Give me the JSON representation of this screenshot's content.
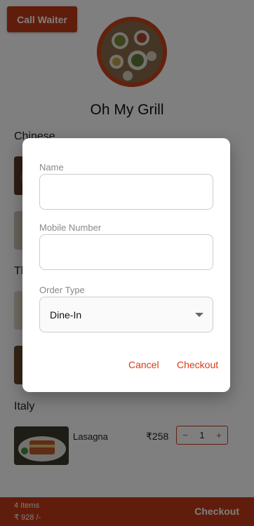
{
  "header": {
    "call_waiter_label": "Call Waiter",
    "restaurant_name": "Oh My Grill"
  },
  "sections": {
    "chinese": "Chinese",
    "second_partial": "Th",
    "italy": "Italy"
  },
  "menu_item": {
    "name": "Lasagna",
    "price": "₹258",
    "minus": "−",
    "quantity": "1",
    "plus": "+"
  },
  "footer": {
    "items_count": "4 Items",
    "total": "₹ 928 /-",
    "checkout_label": "Checkout"
  },
  "dialog": {
    "name_label": "Name",
    "name_value": "",
    "mobile_label": "Mobile Number",
    "mobile_value": "",
    "order_type_label": "Order Type",
    "order_type_value": "Dine-In",
    "cancel_label": "Cancel",
    "checkout_label": "Checkout"
  },
  "colors": {
    "brand": "#c23b16",
    "dialog_button": "#d83a16"
  },
  "icons": [
    "dropdown-caret-icon"
  ]
}
